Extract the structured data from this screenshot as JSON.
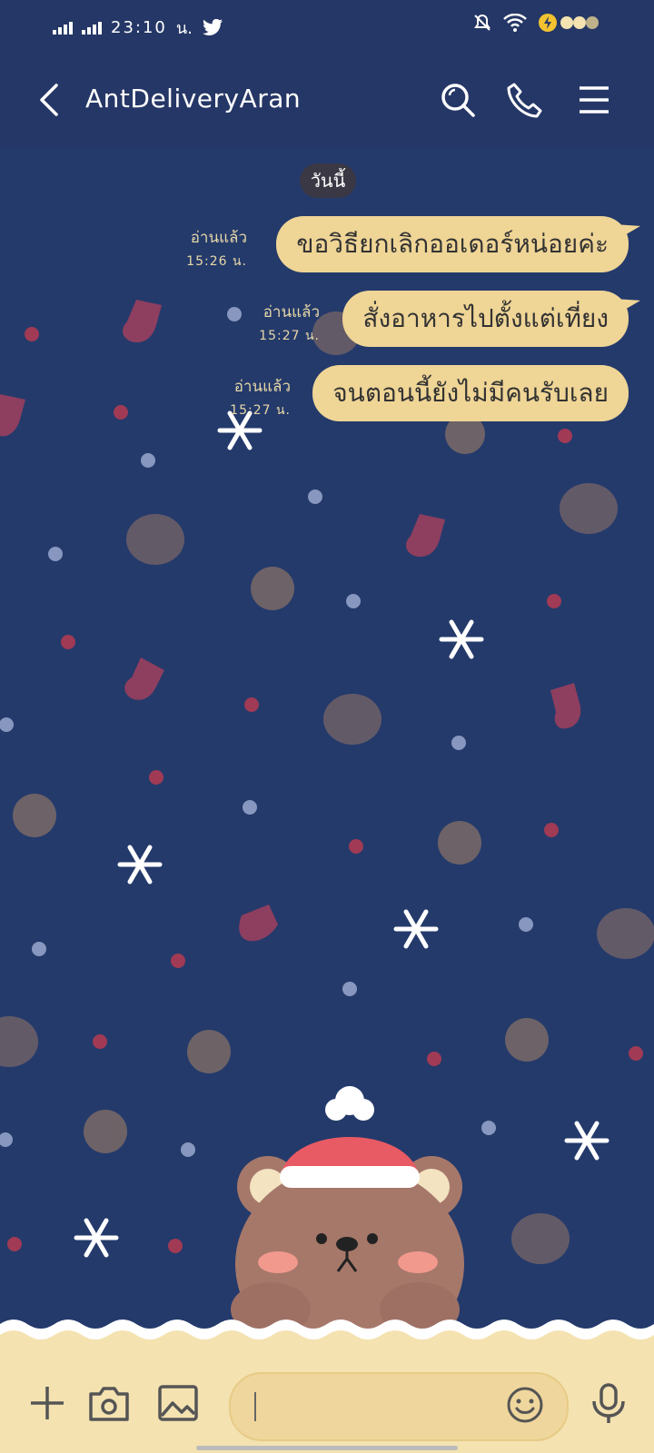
{
  "status_bar": {
    "time": "23:10",
    "time_suffix": "น.",
    "notification_icons": [
      "twitter-icon"
    ],
    "right_icons": [
      "mute-bell-icon",
      "wifi-icon",
      "battery-charging-icon"
    ]
  },
  "header": {
    "title": "AntDeliveryAran",
    "actions": [
      "search-icon",
      "phone-icon",
      "menu-icon"
    ]
  },
  "chat": {
    "date_label": "วันนี้",
    "messages": [
      {
        "text": "ขอวิธียกเลิกออเดอร์หน่อยค่ะ",
        "status": "อ่านแล้ว",
        "time": "15:26 น.",
        "tail": true
      },
      {
        "text": "สั่งอาหารไปตั้งแต่เที่ยง",
        "status": "อ่านแล้ว",
        "time": "15:27 น.",
        "tail": true
      },
      {
        "text": "จนตอนนี้ยังไม่มีคนรับเลย",
        "status": "อ่านแล้ว",
        "time": "15:27 น.",
        "tail": false
      }
    ]
  },
  "composer": {
    "left_icons": [
      "plus-icon",
      "camera-icon",
      "image-icon"
    ],
    "input_value": "",
    "right_icons": [
      "emoji-icon",
      "microphone-icon"
    ]
  },
  "theme": {
    "background": "#243a6b",
    "bubble": "#efd596",
    "composer": "#f4e2b1"
  }
}
